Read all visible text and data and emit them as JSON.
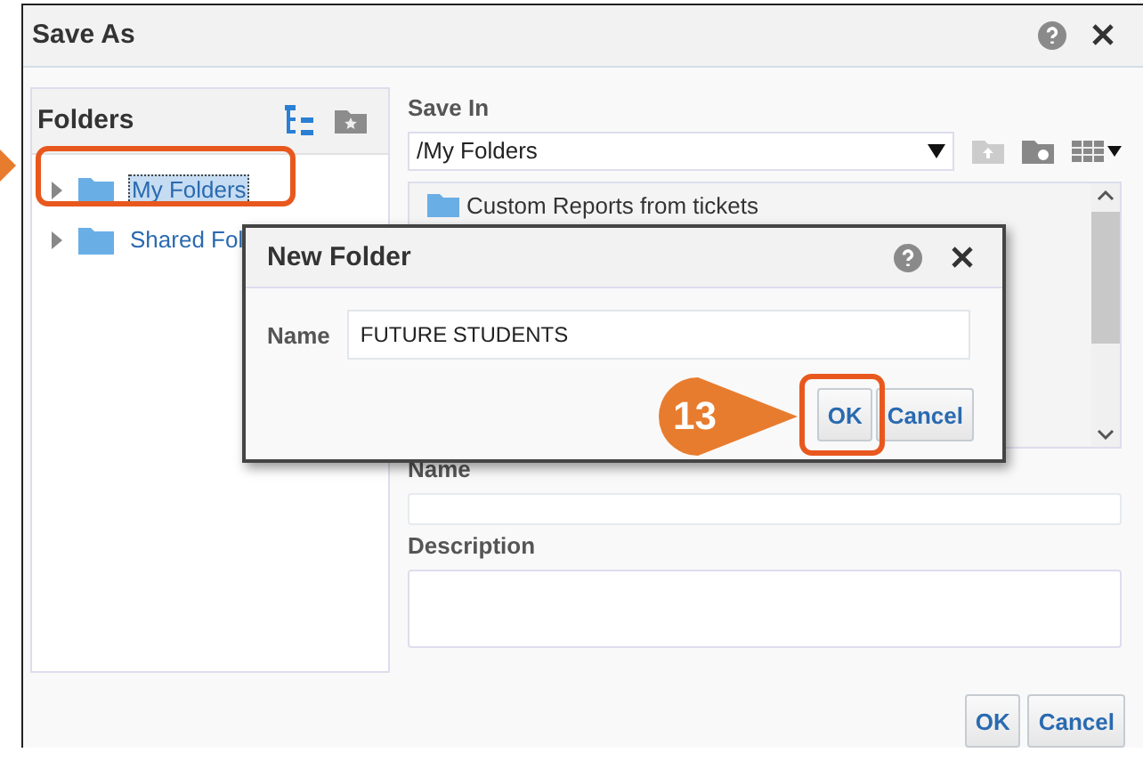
{
  "window": {
    "title": "Save As"
  },
  "folders_panel": {
    "title": "Folders",
    "tree": [
      {
        "label": "My Folders",
        "selected": true,
        "expanded": false
      },
      {
        "label": "Shared Fol",
        "selected": false,
        "expanded": false
      }
    ]
  },
  "save_in": {
    "label": "Save In",
    "path": "/My Folders",
    "list": [
      {
        "label": "Custom Reports from tickets"
      }
    ]
  },
  "name_field": {
    "label": "Name"
  },
  "description_field": {
    "label": "Description"
  },
  "buttons": [
    "OK",
    "Cancel"
  ],
  "new_folder_dialog": {
    "title": "New Folder",
    "name_label": "Name",
    "name_value": "FUTURE STUDENTS",
    "buttons": [
      "OK",
      "Cancel"
    ]
  },
  "callout": {
    "step": "13"
  }
}
